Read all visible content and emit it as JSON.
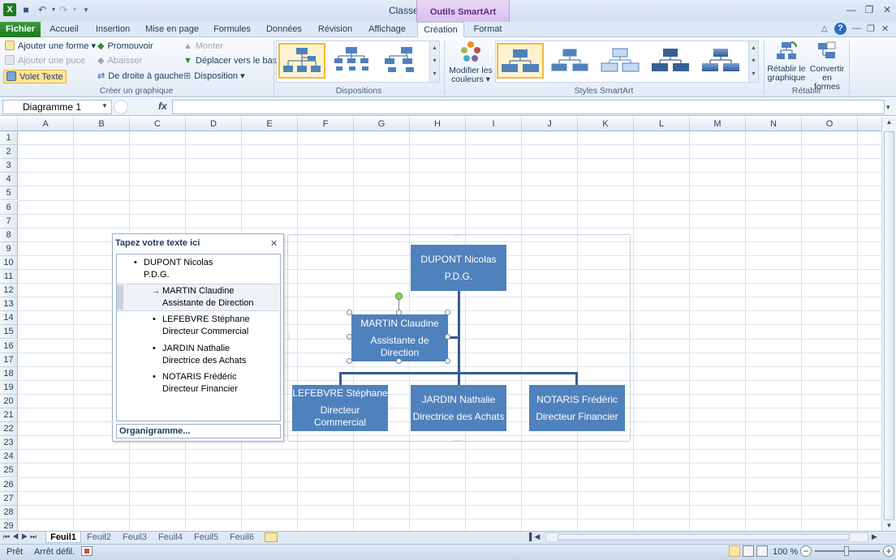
{
  "titlebar": {
    "title": "Classeur1 - Microsoft Excel",
    "contextual": "Outils SmartArt"
  },
  "tabs": [
    "Fichier",
    "Accueil",
    "Insertion",
    "Mise en page",
    "Formules",
    "Données",
    "Révision",
    "Affichage",
    "Création",
    "Format"
  ],
  "ribbon": {
    "create_graphic": {
      "label": "Créer un graphique",
      "add_shape": "Ajouter une forme",
      "add_bullet": "Ajouter une puce",
      "text_pane": "Volet Texte",
      "promote": "Promouvoir",
      "demote": "Abaisser",
      "rtl": "De droite à gauche",
      "move_up": "Monter",
      "move_down": "Déplacer vers le bas",
      "layout": "Disposition"
    },
    "layouts": {
      "label": "Dispositions"
    },
    "colors": {
      "line1": "Modifier les",
      "line2": "couleurs"
    },
    "styles": {
      "label": "Styles SmartArt"
    },
    "reset": {
      "label": "Rétablir",
      "reset1": "Rétablir le",
      "reset2": "graphique",
      "convert1": "Convertir",
      "convert2": "en formes"
    }
  },
  "formula_bar": {
    "name_box": "Diagramme 1",
    "fx": "fx",
    "content": ""
  },
  "columns": [
    "A",
    "B",
    "C",
    "D",
    "E",
    "F",
    "G",
    "H",
    "I",
    "J",
    "K",
    "L",
    "M",
    "N",
    "O"
  ],
  "rows": [
    "1",
    "2",
    "3",
    "4",
    "5",
    "6",
    "7",
    "8",
    "9",
    "10",
    "11",
    "12",
    "13",
    "14",
    "15",
    "16",
    "17",
    "18",
    "19",
    "20",
    "21",
    "22",
    "23",
    "24",
    "25",
    "26",
    "27",
    "28",
    "29"
  ],
  "text_pane": {
    "title": "Tapez votre texte ici",
    "footer": "Organigramme...",
    "items": [
      {
        "name": "DUPONT Nicolas",
        "role": "P.D.G."
      },
      {
        "name": "MARTIN Claudine",
        "role": "Assistante de Direction"
      },
      {
        "name": "LEFEBVRE Stéphane",
        "role": "Directeur Commercial"
      },
      {
        "name": "JARDIN Nathalie",
        "role": "Directrice des Achats"
      },
      {
        "name": "NOTARIS Frédéric",
        "role": "Directeur Financier"
      }
    ]
  },
  "orgchart": {
    "top": {
      "name": "DUPONT Nicolas",
      "role": "P.D.G."
    },
    "assistant": {
      "name": "MARTIN Claudine",
      "role1": "Assistante de",
      "role2": "Direction"
    },
    "sub1": {
      "name": "LEFEBVRE Stéphane",
      "role1": "Directeur",
      "role2": "Commercial"
    },
    "sub2": {
      "name": "JARDIN Nathalie",
      "role": "Directrice des Achats"
    },
    "sub3": {
      "name": "NOTARIS Frédéric",
      "role": "Directeur Financier"
    }
  },
  "sheets": [
    "Feuil1",
    "Feuil2",
    "Feuil3",
    "Feuil4",
    "Feuil5",
    "Feuil6"
  ],
  "status": {
    "ready": "Prêt",
    "scroll": "Arrêt défil.",
    "zoom": "100 %"
  },
  "colors": {
    "accent": "#4f81bd",
    "file_tab": "#1e7b1e",
    "contextual": "#d9bfee"
  }
}
